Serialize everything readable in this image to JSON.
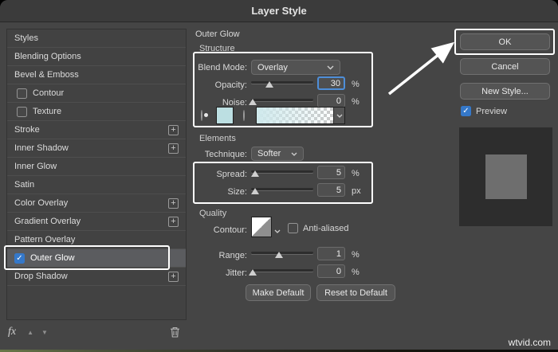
{
  "window": {
    "title": "Layer Style"
  },
  "icons": {
    "plus": "+",
    "check": "✓",
    "up_arrow": "▲",
    "down_arrow": "▼",
    "fx": "fx"
  },
  "sidebar": {
    "items": [
      {
        "label": "Styles"
      },
      {
        "label": "Blending Options"
      },
      {
        "label": "Bevel & Emboss"
      },
      {
        "label": "Contour"
      },
      {
        "label": "Texture"
      },
      {
        "label": "Stroke"
      },
      {
        "label": "Inner Shadow"
      },
      {
        "label": "Inner Glow"
      },
      {
        "label": "Satin"
      },
      {
        "label": "Color Overlay"
      },
      {
        "label": "Gradient Overlay"
      },
      {
        "label": "Pattern Overlay"
      },
      {
        "label": "Outer Glow",
        "checked": true,
        "selected": true
      },
      {
        "label": "Drop Shadow"
      }
    ]
  },
  "panel": {
    "title": "Outer Glow",
    "structure": {
      "heading": "Structure",
      "blend_mode_label": "Blend Mode:",
      "blend_mode_value": "Overlay",
      "opacity_label": "Opacity:",
      "opacity_value": "30",
      "opacity_unit": "%",
      "noise_label": "Noise:",
      "noise_value": "0",
      "noise_unit": "%",
      "glow_color": "#bcdfe2"
    },
    "elements": {
      "heading": "Elements",
      "technique_label": "Technique:",
      "technique_value": "Softer",
      "spread_label": "Spread:",
      "spread_value": "5",
      "spread_unit": "%",
      "size_label": "Size:",
      "size_value": "5",
      "size_unit": "px"
    },
    "quality": {
      "heading": "Quality",
      "contour_label": "Contour:",
      "antialiased_label": "Anti-aliased",
      "range_label": "Range:",
      "range_value": "1",
      "range_unit": "%",
      "jitter_label": "Jitter:",
      "jitter_value": "0",
      "jitter_unit": "%"
    },
    "footer_buttons": {
      "make_default": "Make Default",
      "reset_to_default": "Reset to Default"
    }
  },
  "actions": {
    "ok": "OK",
    "cancel": "Cancel",
    "new_style": "New Style...",
    "preview": "Preview"
  },
  "watermark": "wtvid.com"
}
